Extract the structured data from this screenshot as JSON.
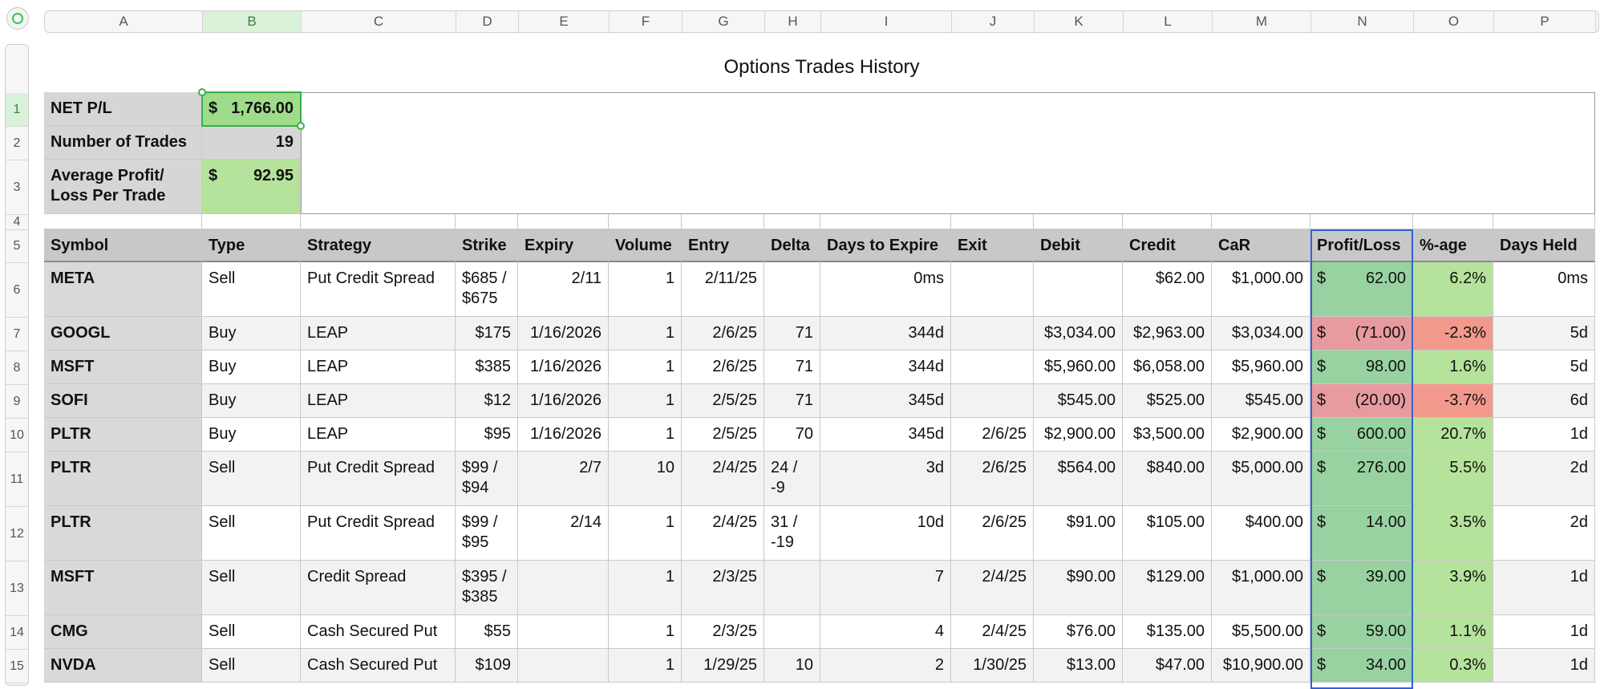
{
  "title": "Options Trades History",
  "columns": [
    "A",
    "B",
    "C",
    "D",
    "E",
    "F",
    "G",
    "H",
    "I",
    "J",
    "K",
    "L",
    "M",
    "N",
    "O",
    "P"
  ],
  "rows": [
    "1",
    "2",
    "3",
    "4",
    "5",
    "6",
    "7",
    "8",
    "9",
    "10",
    "11",
    "12",
    "13",
    "14",
    "15"
  ],
  "summary": [
    {
      "label": "NET P/L",
      "cur": "$",
      "value": "1,766.00"
    },
    {
      "label": "Number of Trades",
      "cur": "",
      "value": "19"
    },
    {
      "label": "Average Profit/ Loss Per Trade",
      "cur": "$",
      "value": "92.95"
    }
  ],
  "headers": [
    "Symbol",
    "Type",
    "Strategy",
    "Strike",
    "Expiry",
    "Volume",
    "Entry",
    "Delta",
    "Days to Expire",
    "Exit",
    "Debit",
    "Credit",
    "CaR",
    "Profit/Loss",
    "%-age",
    "Days Held"
  ],
  "trades": [
    {
      "symbol": "META",
      "type": "Sell",
      "strategy": "Put Credit Spread",
      "strike": "$685 / $675",
      "expiry": "2/11",
      "volume": "1",
      "entry": "2/11/25",
      "delta": "",
      "dte": "0ms",
      "exit": "",
      "debit": "",
      "credit": "$62.00",
      "car": "$1,000.00",
      "pl": "62.00",
      "pct": "6.2%",
      "held": "0ms",
      "status": "profit"
    },
    {
      "symbol": "GOOGL",
      "type": "Buy",
      "strategy": "LEAP",
      "strike": "$175",
      "expiry": "1/16/2026",
      "volume": "1",
      "entry": "2/6/25",
      "delta": "71",
      "dte": "344d",
      "exit": "",
      "debit": "$3,034.00",
      "credit": "$2,963.00",
      "car": "$3,034.00",
      "pl": "(71.00)",
      "pct": "-2.3%",
      "held": "5d",
      "status": "loss"
    },
    {
      "symbol": "MSFT",
      "type": "Buy",
      "strategy": "LEAP",
      "strike": "$385",
      "expiry": "1/16/2026",
      "volume": "1",
      "entry": "2/6/25",
      "delta": "71",
      "dte": "344d",
      "exit": "",
      "debit": "$5,960.00",
      "credit": "$6,058.00",
      "car": "$5,960.00",
      "pl": "98.00",
      "pct": "1.6%",
      "held": "5d",
      "status": "profit"
    },
    {
      "symbol": "SOFI",
      "type": "Buy",
      "strategy": "LEAP",
      "strike": "$12",
      "expiry": "1/16/2026",
      "volume": "1",
      "entry": "2/5/25",
      "delta": "71",
      "dte": "345d",
      "exit": "",
      "debit": "$545.00",
      "credit": "$525.00",
      "car": "$545.00",
      "pl": "(20.00)",
      "pct": "-3.7%",
      "held": "6d",
      "status": "loss"
    },
    {
      "symbol": "PLTR",
      "type": "Buy",
      "strategy": "LEAP",
      "strike": "$95",
      "expiry": "1/16/2026",
      "volume": "1",
      "entry": "2/5/25",
      "delta": "70",
      "dte": "345d",
      "exit": "2/6/25",
      "debit": "$2,900.00",
      "credit": "$3,500.00",
      "car": "$2,900.00",
      "pl": "600.00",
      "pct": "20.7%",
      "held": "1d",
      "status": "profit"
    },
    {
      "symbol": "PLTR",
      "type": "Sell",
      "strategy": "Put Credit Spread",
      "strike": "$99 / $94",
      "expiry": "2/7",
      "volume": "10",
      "entry": "2/4/25",
      "delta": "24 / -9",
      "dte": "3d",
      "exit": "2/6/25",
      "debit": "$564.00",
      "credit": "$840.00",
      "car": "$5,000.00",
      "pl": "276.00",
      "pct": "5.5%",
      "held": "2d",
      "status": "profit"
    },
    {
      "symbol": "PLTR",
      "type": "Sell",
      "strategy": "Put Credit Spread",
      "strike": "$99 / $95",
      "expiry": "2/14",
      "volume": "1",
      "entry": "2/4/25",
      "delta": "31 / -19",
      "dte": "10d",
      "exit": "2/6/25",
      "debit": "$91.00",
      "credit": "$105.00",
      "car": "$400.00",
      "pl": "14.00",
      "pct": "3.5%",
      "held": "2d",
      "status": "profit"
    },
    {
      "symbol": "MSFT",
      "type": "Sell",
      "strategy": "Credit Spread",
      "strike": "$395 / $385",
      "expiry": "",
      "volume": "1",
      "entry": "2/3/25",
      "delta": "",
      "dte": "7",
      "exit": "2/4/25",
      "debit": "$90.00",
      "credit": "$129.00",
      "car": "$1,000.00",
      "pl": "39.00",
      "pct": "3.9%",
      "held": "1d",
      "status": "profit"
    },
    {
      "symbol": "CMG",
      "type": "Sell",
      "strategy": "Cash Secured Put",
      "strike": "$55",
      "expiry": "",
      "volume": "1",
      "entry": "2/3/25",
      "delta": "",
      "dte": "4",
      "exit": "2/4/25",
      "debit": "$76.00",
      "credit": "$135.00",
      "car": "$5,500.00",
      "pl": "59.00",
      "pct": "1.1%",
      "held": "1d",
      "status": "profit"
    },
    {
      "symbol": "NVDA",
      "type": "Sell",
      "strategy": "Cash Secured Put",
      "strike": "$109",
      "expiry": "",
      "volume": "1",
      "entry": "1/29/25",
      "delta": "10",
      "dte": "2",
      "exit": "1/30/25",
      "debit": "$13.00",
      "credit": "$47.00",
      "car": "$10,900.00",
      "pl": "34.00",
      "pct": "0.3%",
      "held": "1d",
      "status": "profit"
    }
  ],
  "colors": {
    "profit_cell": "#98d2a0",
    "loss_cell": "#e79b9f",
    "profit_pct": "#b5e39b",
    "loss_pct": "#f3998c",
    "selection": "#34b24a",
    "column_selection": "#2f62d6"
  }
}
